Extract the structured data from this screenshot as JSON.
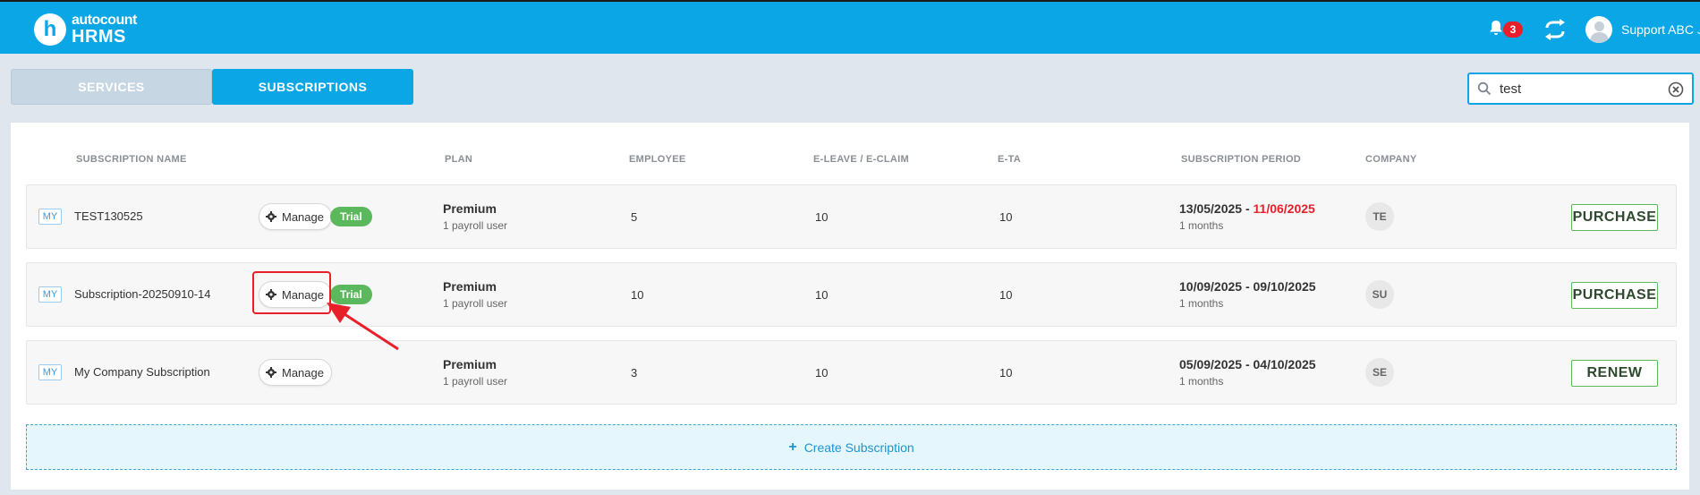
{
  "header": {
    "logo_top": "autocount",
    "logo_bottom": "HRMS",
    "logo_letter": "h",
    "notification_count": "3",
    "user_name": "Support ABC"
  },
  "tabs": [
    {
      "label": "SERVICES",
      "active": false
    },
    {
      "label": "SUBSCRIPTIONS",
      "active": true
    }
  ],
  "search": {
    "value": "test"
  },
  "columns": {
    "name": "SUBSCRIPTION NAME",
    "plan": "PLAN",
    "employee": "EMPLOYEE",
    "eleave": "E-LEAVE / E-CLAIM",
    "eta": "E-TA",
    "period": "SUBSCRIPTION PERIOD",
    "company": "COMPANY"
  },
  "rows": [
    {
      "country": "MY",
      "name": "TEST130525",
      "manage_label": "Manage",
      "trial_label": "Trial",
      "plan": "Premium",
      "plan_sub": "1 payroll user",
      "employee": "5",
      "eleave": "10",
      "eta": "10",
      "period_start": "13/05/2025 - ",
      "period_end": "11/06/2025",
      "period_sub": "1 months",
      "company": "TE",
      "action": "PURCHASE"
    },
    {
      "country": "MY",
      "name": "Subscription-20250910-14",
      "manage_label": "Manage",
      "trial_label": "Trial",
      "plan": "Premium",
      "plan_sub": "1 payroll user",
      "employee": "10",
      "eleave": "10",
      "eta": "10",
      "period": "10/09/2025 - 09/10/2025",
      "period_sub": "1 months",
      "company": "SU",
      "action": "PURCHASE"
    },
    {
      "country": "MY",
      "name": "My Company Subscription",
      "manage_label": "Manage",
      "plan": "Premium",
      "plan_sub": "1 payroll user",
      "employee": "3",
      "eleave": "10",
      "eta": "10",
      "period": "05/09/2025 - 04/10/2025",
      "period_sub": "1 months",
      "company": "SE",
      "action": "RENEW"
    }
  ],
  "create_label": "Create Subscription",
  "colors": {
    "brand": "#0aa6e6",
    "trial": "#5cb85c",
    "danger": "#e8202a"
  }
}
